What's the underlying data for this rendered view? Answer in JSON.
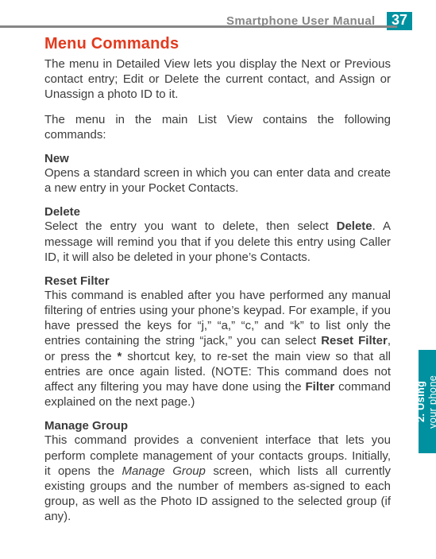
{
  "header": {
    "title": "Smartphone User Manual",
    "page_number": "37"
  },
  "side_tab": {
    "line1": "2. Using",
    "line2": "your phone"
  },
  "section": {
    "heading": "Menu Commands",
    "intro1": "The menu in Detailed View lets you display the Next or Previous contact entry; Edit or Delete the current contact, and Assign or Unassign a photo ID to it.",
    "intro2": "The menu in the main List View contains the following commands:"
  },
  "commands": {
    "new": {
      "name": "New",
      "desc": "Opens a standard screen in which you can enter data and create a new entry in your Pocket Contacts."
    },
    "delete": {
      "name": "Delete",
      "desc_pre": "Select the entry you want to delete, then select ",
      "keyword": "Delete",
      "desc_post": ".  A message will remind you that if you delete this entry using Caller ID, it will also be deleted in your phone’s Contacts."
    },
    "reset_filter": {
      "name": "Reset Filter",
      "p1": "This command is enabled after you have performed any manual filtering of entries using your phone’s keypad.  For example, if you have pressed the keys for “j,” “a,” “c,” and “k” to list only the entries containing the string “jack,” you can select ",
      "kw1": "Reset Filter",
      "p2": ", or press the ",
      "star": "*",
      "p3": " shortcut key, to re-set the main view so that all entries are once again listed.  (NOTE:  This command does not affect any filtering you may have done using the ",
      "kw2": "Filter",
      "p4": " command explained on the next page.)"
    },
    "manage_group": {
      "name": "Manage Group",
      "p1": "This command provides a convenient interface that lets you perform complete management of your contacts groups.  Initially, it opens the ",
      "screen_name": "Manage Group",
      "p2": " screen, which lists all currently existing groups and the number of members as-signed to each group, as well as the Photo ID assigned to the selected group (if any)."
    }
  }
}
